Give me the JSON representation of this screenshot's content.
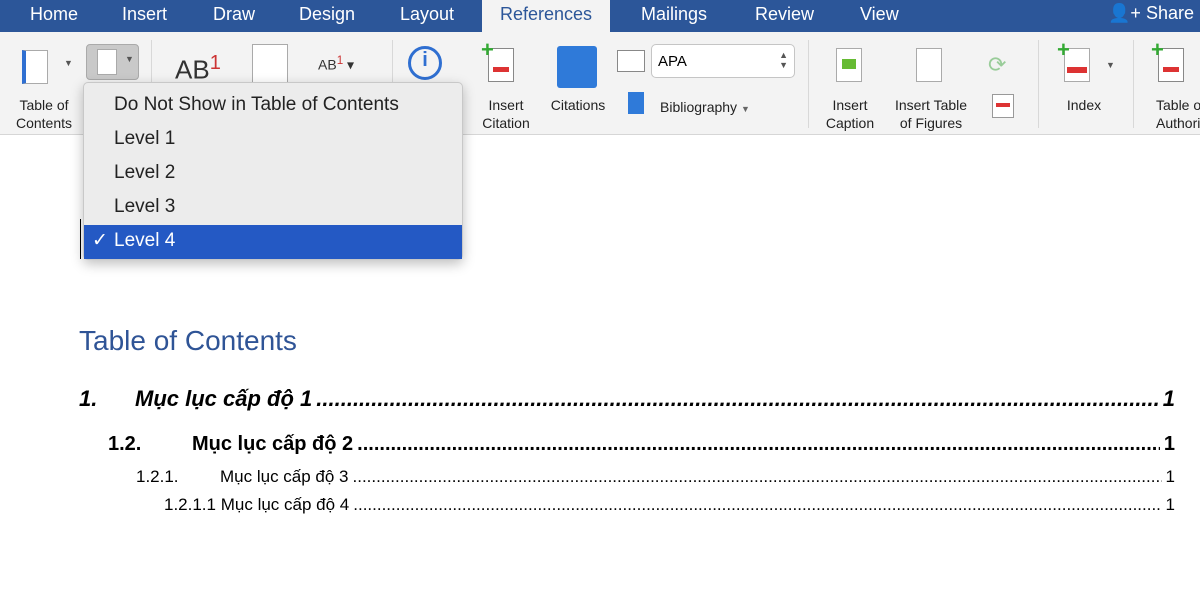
{
  "tabs": [
    "Home",
    "Insert",
    "Draw",
    "Design",
    "Layout",
    "References",
    "Mailings",
    "Review",
    "View"
  ],
  "active_tab": "References",
  "share_label": "Share",
  "ribbon": {
    "toc_label1": "Table of",
    "toc_label2": "Contents",
    "insert_citation1": "Insert",
    "insert_citation2": "Citation",
    "citations": "Citations",
    "style_value": "APA",
    "bibliography": "Bibliography",
    "insert_caption1": "Insert",
    "insert_caption2": "Caption",
    "insert_tof1": "Insert Table",
    "insert_tof2": "of Figures",
    "index": "Index",
    "toa1": "Table of",
    "toa2": "Authorities",
    "footnote_glyph": "AB",
    "footnote_sup": "1"
  },
  "menu": {
    "items": [
      "Do Not Show in Table of Contents",
      "Level 1",
      "Level 2",
      "Level 3",
      "Level 4"
    ],
    "selected": "Level 4",
    "check": "✓"
  },
  "document": {
    "heading": "Table of Contents",
    "entries": [
      {
        "num": "1.",
        "text": "Mục lục cấp độ 1",
        "page": "1"
      },
      {
        "num": "1.2.",
        "text": "Mục lục cấp độ 2",
        "page": "1"
      },
      {
        "num": "1.2.1.",
        "text": "Mục lục cấp độ 3",
        "page": "1"
      },
      {
        "num": "1.2.1.1",
        "text": "Mục lục cấp độ 4",
        "page": "1"
      }
    ]
  },
  "colors": {
    "tabbar": "#2c5699",
    "selection": "#2459c4",
    "heading": "#2f5496"
  }
}
